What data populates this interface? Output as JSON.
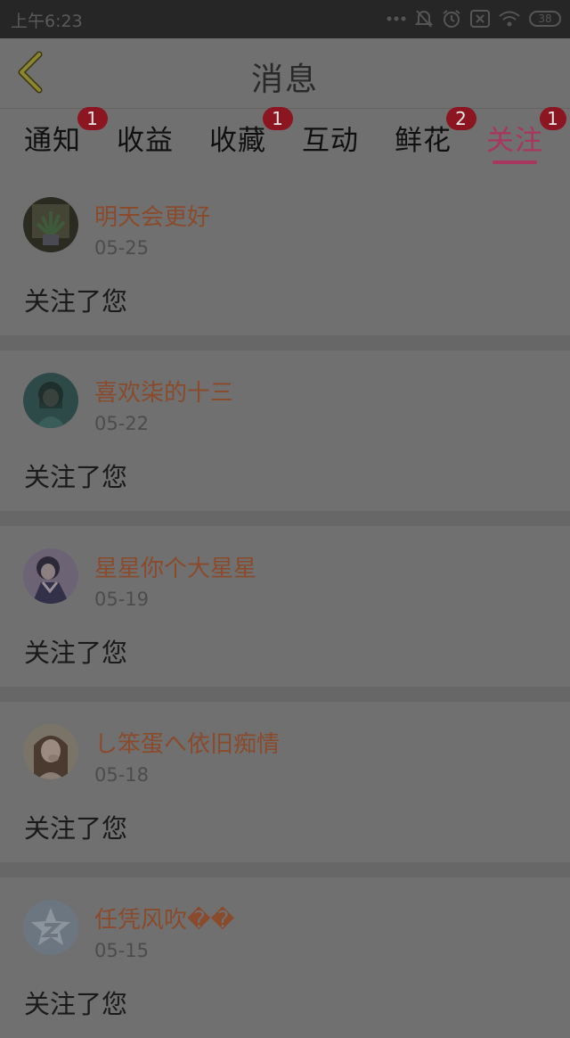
{
  "status_bar": {
    "time": "上午6:23",
    "battery": "38"
  },
  "header": {
    "title": "消息"
  },
  "tabs": [
    {
      "label": "通知",
      "badge": "1"
    },
    {
      "label": "收益",
      "badge": ""
    },
    {
      "label": "收藏",
      "badge": "1"
    },
    {
      "label": "互动",
      "badge": ""
    },
    {
      "label": "鲜花",
      "badge": "2"
    },
    {
      "label": "关注",
      "badge": "1",
      "active": true
    }
  ],
  "items": [
    {
      "username": "明天会更好",
      "date": "05-25",
      "message": "关注了您",
      "avatar": "plant-photo-avatar"
    },
    {
      "username": "喜欢柒的十三",
      "date": "05-22",
      "message": "关注了您",
      "avatar": "anime-girl-avatar"
    },
    {
      "username": "星星你个大星星",
      "date": "05-19",
      "message": "关注了您",
      "avatar": "anime-sailor-avatar"
    },
    {
      "username": "し笨蛋へ依旧痴情",
      "date": "05-18",
      "message": "关注了您",
      "avatar": "girl-photo-avatar"
    },
    {
      "username": "任凭风吹��",
      "date": "05-15",
      "message": "关注了您",
      "avatar": "default-qzone-avatar"
    }
  ],
  "colors": {
    "accent": "#a8365f",
    "username": "#8a4a2c",
    "badge": "#8b1520"
  }
}
